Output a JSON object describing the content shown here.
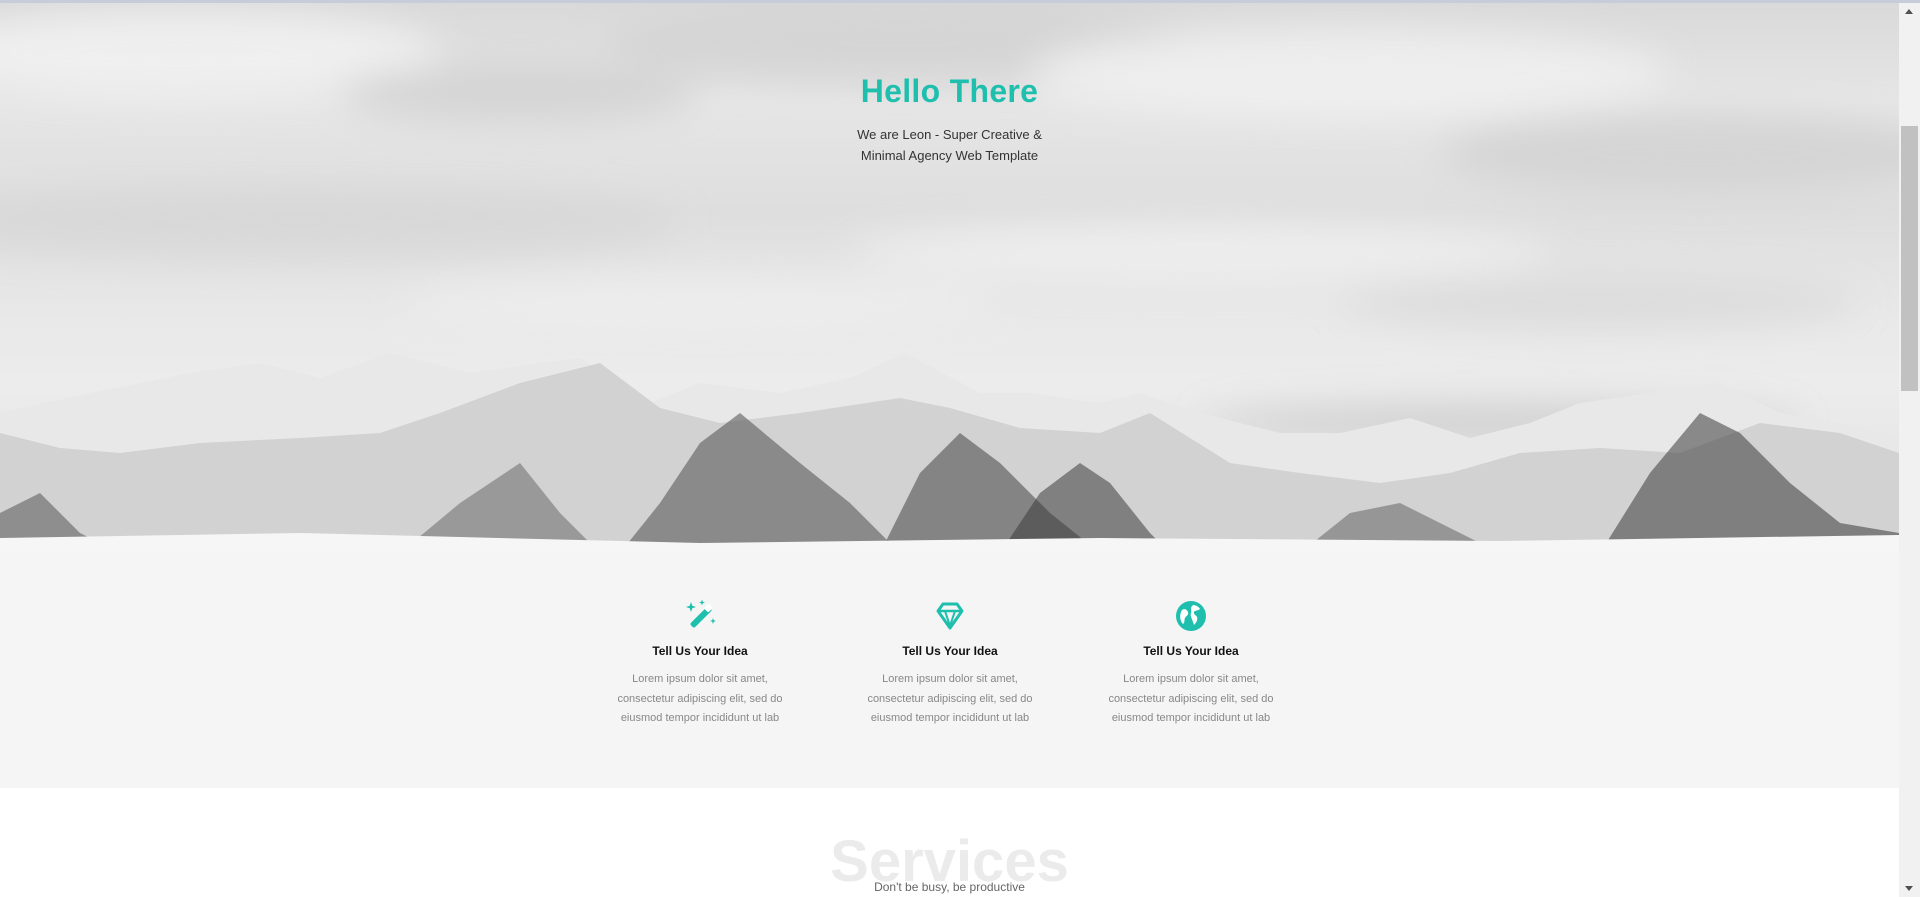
{
  "hero": {
    "title": "Hello There",
    "subtitle_lines": [
      "We are Leon - Super Creative &",
      "Minimal Agency Web Template"
    ]
  },
  "features": [
    {
      "icon": "magic-wand-icon",
      "title": "Tell Us Your Idea",
      "lines": [
        "Lorem ipsum dolor sit amet,",
        "consectetur adipiscing elit, sed do",
        "eiusmod tempor incididunt ut lab"
      ]
    },
    {
      "icon": "diamond-icon",
      "title": "Tell Us Your Idea",
      "lines": [
        "Lorem ipsum dolor sit amet,",
        "consectetur adipiscing elit, sed do",
        "eiusmod tempor incididunt ut lab"
      ]
    },
    {
      "icon": "globe-icon",
      "title": "Tell Us Your Idea",
      "lines": [
        "Lorem ipsum dolor sit amet,",
        "consectetur adipiscing elit, sed do",
        "eiusmod tempor incididunt ut lab"
      ]
    }
  ],
  "services": {
    "watermark": "Services",
    "tagline": "Don't be busy, be productive"
  },
  "colors": {
    "accent": "#1fbfae",
    "feature_band": "#f5f5f5",
    "text_dark": "#111111",
    "text_muted": "#888888"
  }
}
